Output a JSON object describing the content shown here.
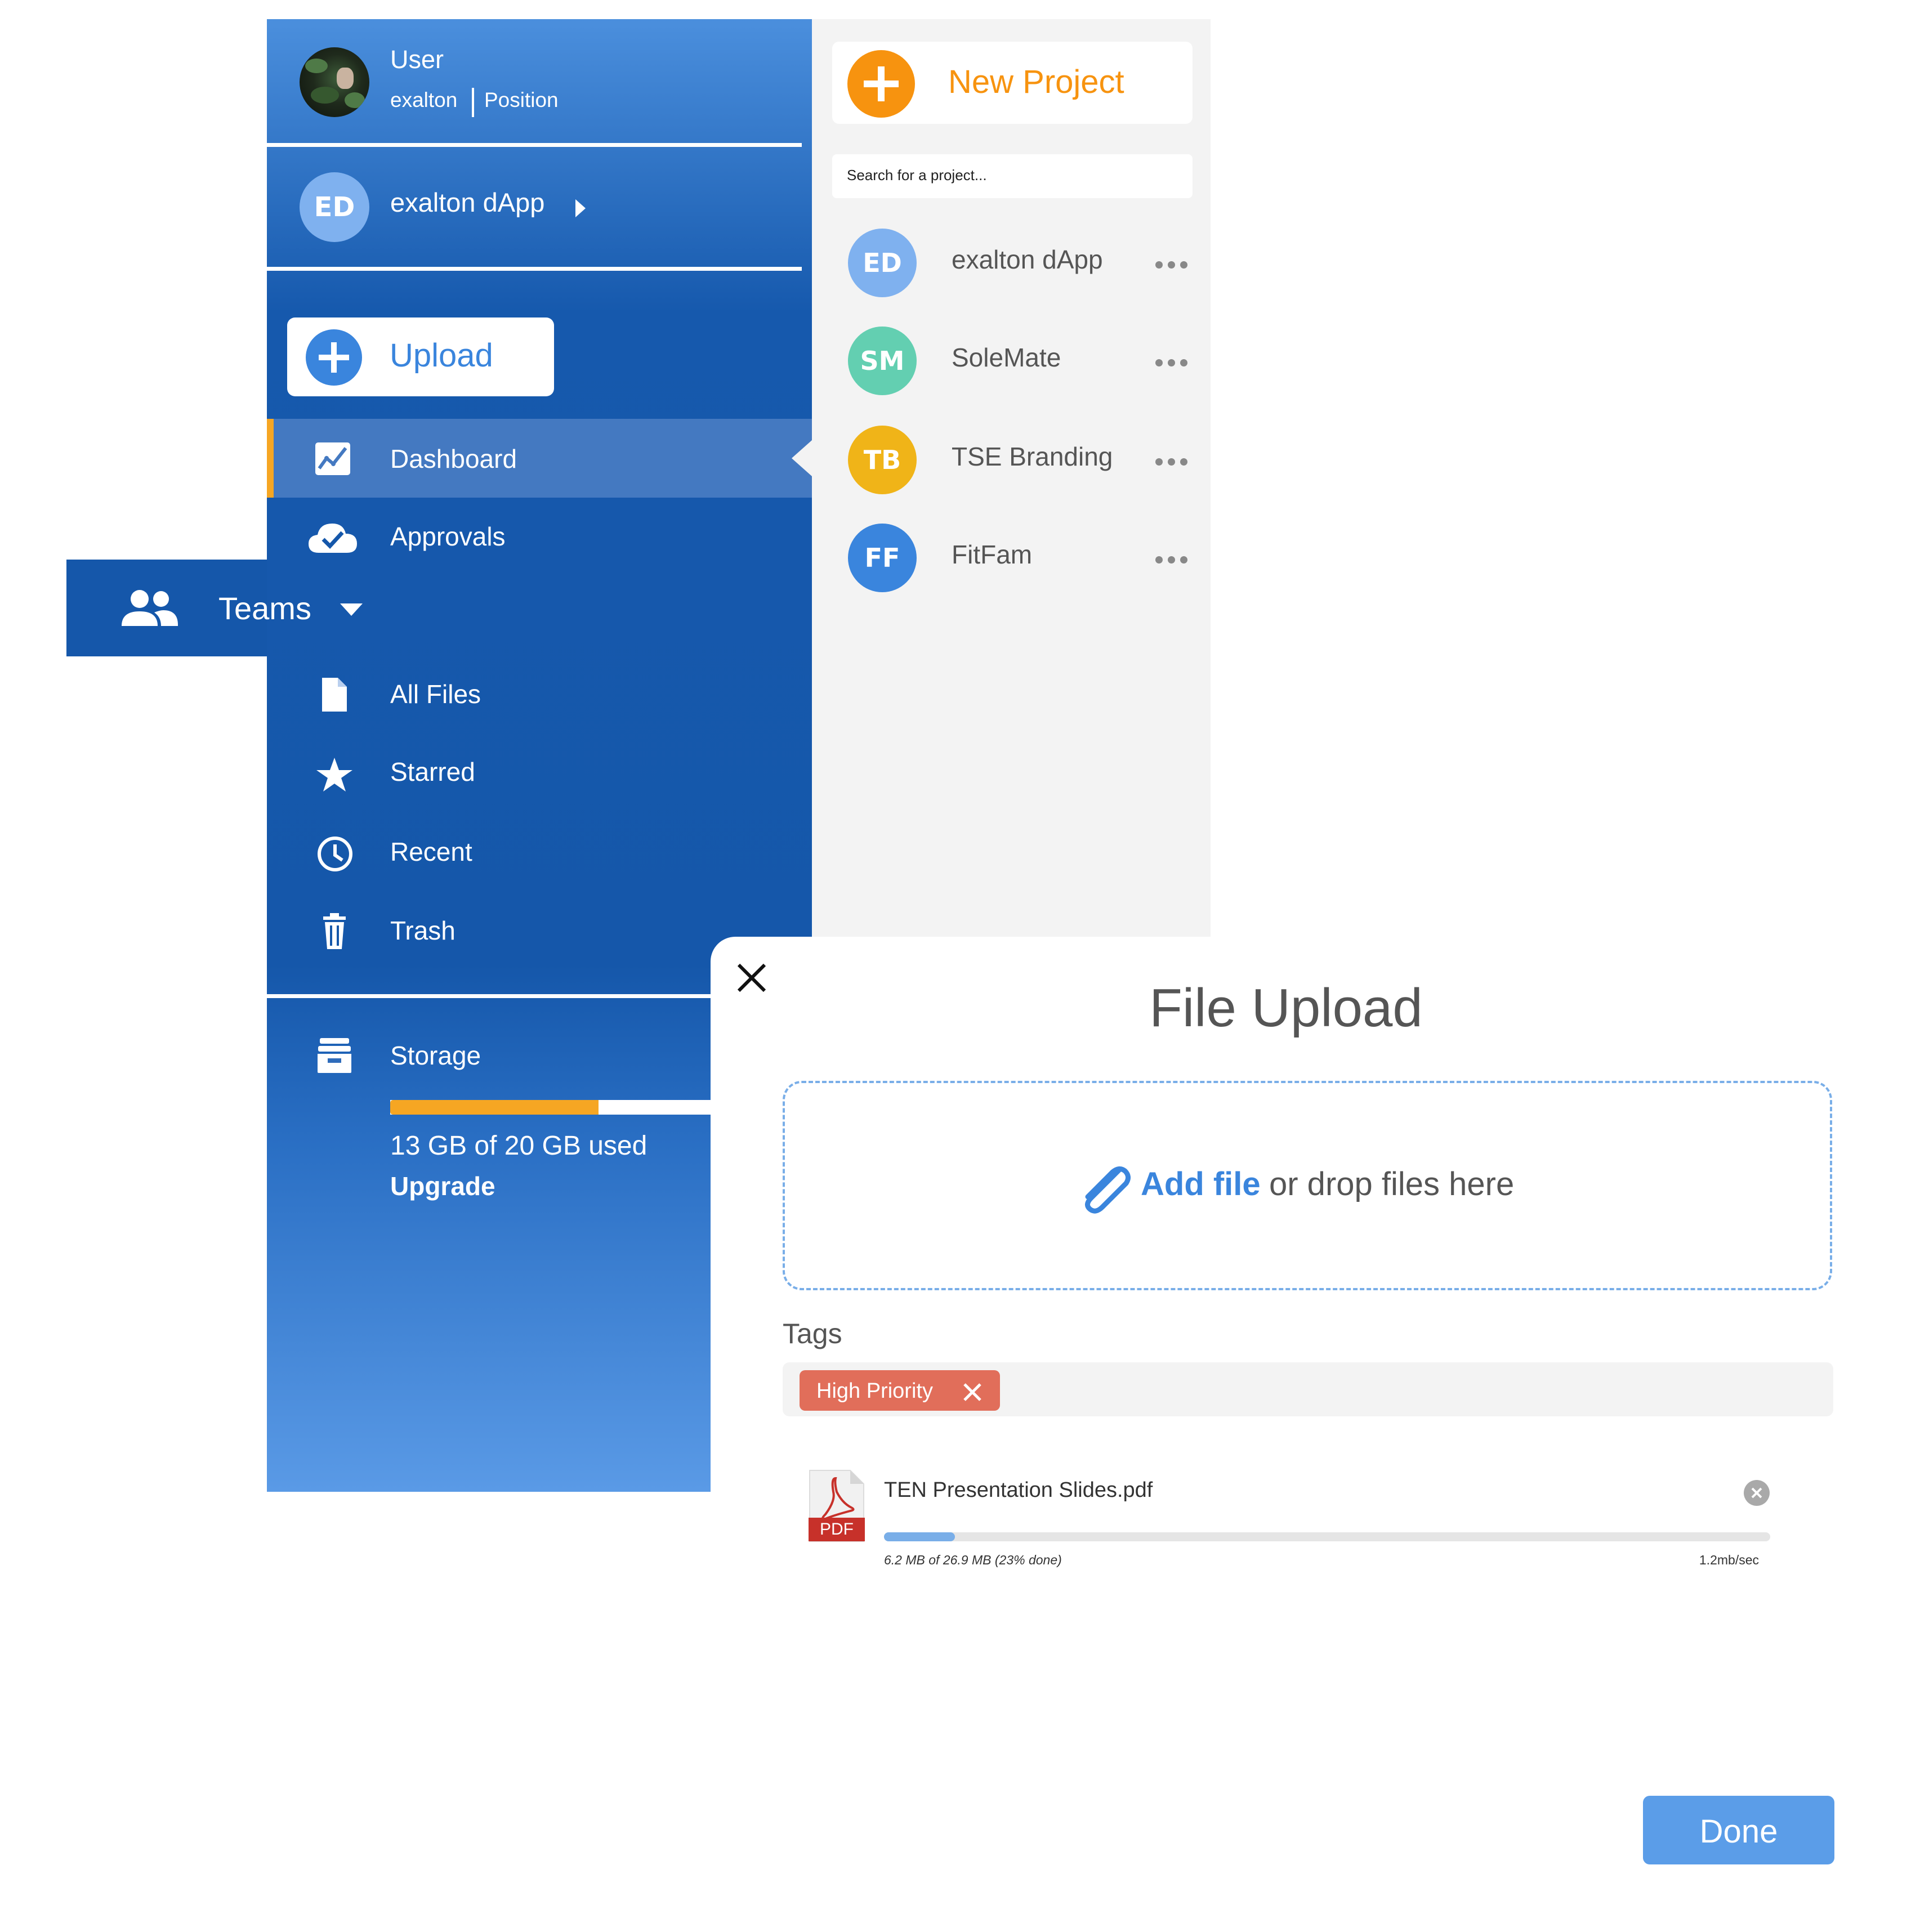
{
  "user": {
    "title": "User",
    "username": "exalton",
    "position": "Position"
  },
  "workspace": {
    "initials": "ED",
    "name": "exalton dApp"
  },
  "upload_button": {
    "label": "Upload"
  },
  "nav": {
    "dashboard": "Dashboard",
    "approvals": "Approvals",
    "teams": "Teams",
    "all_files": "All Files",
    "starred": "Starred",
    "recent": "Recent",
    "trash": "Trash"
  },
  "storage": {
    "label": "Storage",
    "used_fraction": 0.65,
    "usage_text": "13 GB of 20 GB used",
    "upgrade_label": "Upgrade"
  },
  "projects_panel": {
    "new_project_label": "New Project",
    "search_placeholder": "Search for a project...",
    "projects": [
      {
        "initials": "ED",
        "name": "exalton dApp",
        "color": "#7fb1ef"
      },
      {
        "initials": "SM",
        "name": "SoleMate",
        "color": "#63cfb1"
      },
      {
        "initials": "TB",
        "name": "TSE Branding",
        "color": "#f0b418"
      },
      {
        "initials": "FF",
        "name": "FitFam",
        "color": "#3a85dd"
      }
    ]
  },
  "modal": {
    "title": "File Upload",
    "dropzone": {
      "add_file_label": "Add file",
      "drop_text": "or drop files here"
    },
    "tags_label": "Tags",
    "tags": [
      {
        "label": "High Priority",
        "color": "#e16e5a"
      }
    ],
    "file": {
      "name": "TEN Presentation Slides.pdf",
      "type_badge": "PDF",
      "progress_fraction": 0.08,
      "progress_text": "6.2 MB of 26.9 MB (23% done)",
      "speed": "1.2mb/sec"
    },
    "done_label": "Done"
  },
  "colors": {
    "accent_blue": "#3a85dd",
    "sidebar_blue": "#1557aa",
    "orange": "#f7930f",
    "storage_bar": "#f6a623",
    "done_button": "#5b9de8"
  }
}
